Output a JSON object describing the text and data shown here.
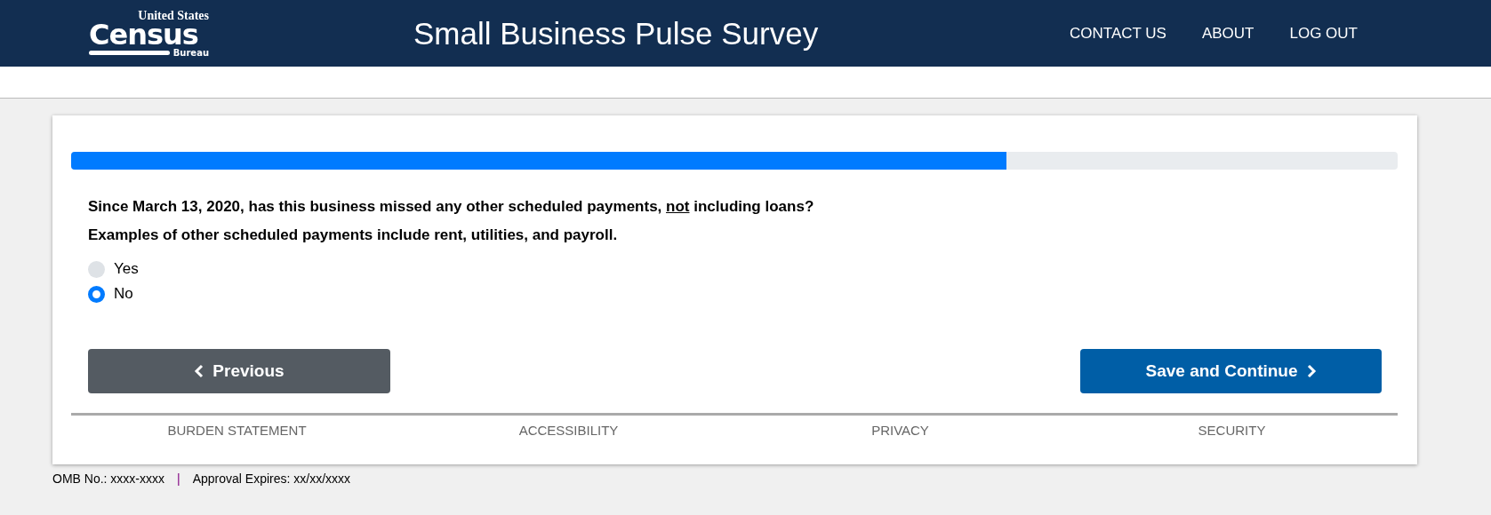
{
  "header": {
    "logo": {
      "top": "United States",
      "main": "Census",
      "bottom": "Bureau"
    },
    "title": "Small Business Pulse Survey",
    "nav": [
      "CONTACT US",
      "ABOUT",
      "LOG OUT"
    ]
  },
  "progress": {
    "level": 0.705
  },
  "question": {
    "before": "Since March 13, 2020, has this business missed any other scheduled payments, ",
    "underlined": "not",
    "after": " including loans?",
    "hint": "Examples of other scheduled payments include rent, utilities, and payroll."
  },
  "options": [
    {
      "label": "Yes",
      "selected": false
    },
    {
      "label": "No",
      "selected": true
    }
  ],
  "buttons": {
    "previous": "Previous",
    "next": "Save and Continue"
  },
  "footer_links": [
    "BURDEN STATEMENT",
    "ACCESSIBILITY",
    "PRIVACY",
    "SECURITY"
  ],
  "omb": {
    "number": "OMB No.: xxxx-xxxx",
    "separator": "|",
    "expires": "Approval Expires: xx/xx/xxxx"
  }
}
